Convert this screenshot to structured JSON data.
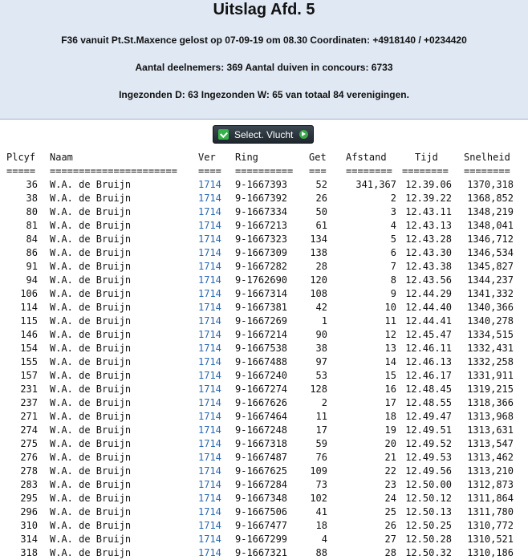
{
  "header": {
    "title": "Uitslag Afd. 5",
    "race_info": "F36 vanuit Pt.St.Maxence gelost op 07-09-19 om 08.30 Coordinaten: +4918140 / +0234420",
    "participants": "Aantal deelnemers: 369 Aantal duiven in concours: 6733",
    "submitted": "Ingezonden D: 63 Ingezonden W: 65 van totaal 84 verenigingen."
  },
  "select_button": {
    "label": "Select. Vlucht",
    "left_icon": "check-icon",
    "right_icon": "arrow-right-icon"
  },
  "table": {
    "columns": [
      "Plcyf",
      "Naam",
      "Ver",
      "Ring",
      "Get",
      "Afstand",
      "Tijd",
      "Snelheid"
    ],
    "separators": [
      "=====",
      "======================",
      "====",
      "==========",
      "===",
      "========",
      "========",
      "========"
    ],
    "rows": [
      [
        "36",
        "W.A. de Bruijn",
        "1714",
        "9-1667393",
        "52",
        "341,367",
        "12.39.06",
        "1370,318"
      ],
      [
        "38",
        "W.A. de Bruijn",
        "1714",
        "9-1667392",
        "26",
        "2",
        "12.39.22",
        "1368,852"
      ],
      [
        "80",
        "W.A. de Bruijn",
        "1714",
        "9-1667334",
        "50",
        "3",
        "12.43.11",
        "1348,219"
      ],
      [
        "81",
        "W.A. de Bruijn",
        "1714",
        "9-1667213",
        "61",
        "4",
        "12.43.13",
        "1348,041"
      ],
      [
        "84",
        "W.A. de Bruijn",
        "1714",
        "9-1667323",
        "134",
        "5",
        "12.43.28",
        "1346,712"
      ],
      [
        "86",
        "W.A. de Bruijn",
        "1714",
        "9-1667309",
        "138",
        "6",
        "12.43.30",
        "1346,534"
      ],
      [
        "91",
        "W.A. de Bruijn",
        "1714",
        "9-1667282",
        "28",
        "7",
        "12.43.38",
        "1345,827"
      ],
      [
        "94",
        "W.A. de Bruijn",
        "1714",
        "9-1762690",
        "120",
        "8",
        "12.43.56",
        "1344,237"
      ],
      [
        "106",
        "W.A. de Bruijn",
        "1714",
        "9-1667314",
        "108",
        "9",
        "12.44.29",
        "1341,332"
      ],
      [
        "114",
        "W.A. de Bruijn",
        "1714",
        "9-1667381",
        "42",
        "10",
        "12.44.40",
        "1340,366"
      ],
      [
        "115",
        "W.A. de Bruijn",
        "1714",
        "9-1667269",
        "1",
        "11",
        "12.44.41",
        "1340,278"
      ],
      [
        "146",
        "W.A. de Bruijn",
        "1714",
        "9-1667214",
        "90",
        "12",
        "12.45.47",
        "1334,515"
      ],
      [
        "154",
        "W.A. de Bruijn",
        "1714",
        "9-1667538",
        "38",
        "13",
        "12.46.11",
        "1332,431"
      ],
      [
        "155",
        "W.A. de Bruijn",
        "1714",
        "9-1667488",
        "97",
        "14",
        "12.46.13",
        "1332,258"
      ],
      [
        "157",
        "W.A. de Bruijn",
        "1714",
        "9-1667240",
        "53",
        "15",
        "12.46.17",
        "1331,911"
      ],
      [
        "231",
        "W.A. de Bruijn",
        "1714",
        "9-1667274",
        "128",
        "16",
        "12.48.45",
        "1319,215"
      ],
      [
        "237",
        "W.A. de Bruijn",
        "1714",
        "9-1667626",
        "2",
        "17",
        "12.48.55",
        "1318,366"
      ],
      [
        "271",
        "W.A. de Bruijn",
        "1714",
        "9-1667464",
        "11",
        "18",
        "12.49.47",
        "1313,968"
      ],
      [
        "274",
        "W.A. de Bruijn",
        "1714",
        "9-1667248",
        "17",
        "19",
        "12.49.51",
        "1313,631"
      ],
      [
        "275",
        "W.A. de Bruijn",
        "1714",
        "9-1667318",
        "59",
        "20",
        "12.49.52",
        "1313,547"
      ],
      [
        "276",
        "W.A. de Bruijn",
        "1714",
        "9-1667487",
        "76",
        "21",
        "12.49.53",
        "1313,462"
      ],
      [
        "278",
        "W.A. de Bruijn",
        "1714",
        "9-1667625",
        "109",
        "22",
        "12.49.56",
        "1313,210"
      ],
      [
        "283",
        "W.A. de Bruijn",
        "1714",
        "9-1667284",
        "73",
        "23",
        "12.50.00",
        "1312,873"
      ],
      [
        "295",
        "W.A. de Bruijn",
        "1714",
        "9-1667348",
        "102",
        "24",
        "12.50.12",
        "1311,864"
      ],
      [
        "296",
        "W.A. de Bruijn",
        "1714",
        "9-1667506",
        "41",
        "25",
        "12.50.13",
        "1311,780"
      ],
      [
        "310",
        "W.A. de Bruijn",
        "1714",
        "9-1667477",
        "18",
        "26",
        "12.50.25",
        "1310,772"
      ],
      [
        "314",
        "W.A. de Bruijn",
        "1714",
        "9-1667299",
        "4",
        "27",
        "12.50.28",
        "1310,521"
      ],
      [
        "318",
        "W.A. de Bruijn",
        "1714",
        "9-1667321",
        "88",
        "28",
        "12.50.32",
        "1310,186"
      ]
    ]
  },
  "colors": {
    "header_bg": "#dfe8f3",
    "link": "#2a68b2",
    "button_bg": "#2b343c"
  }
}
